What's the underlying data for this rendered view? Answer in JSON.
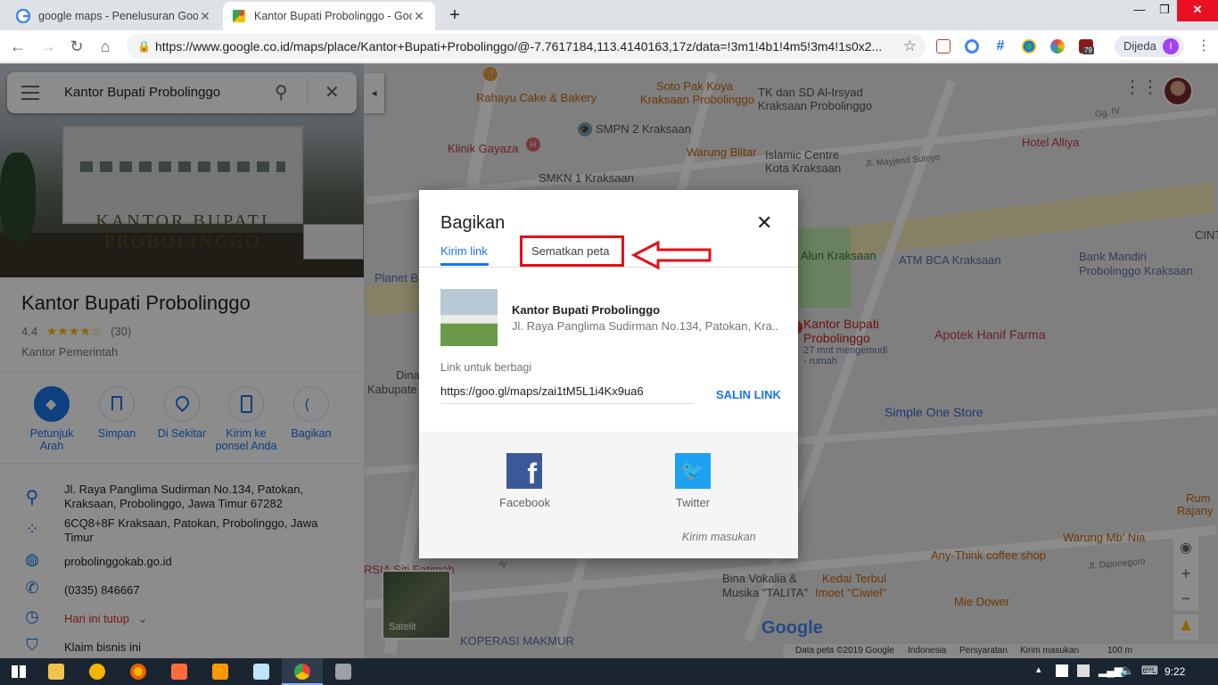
{
  "browser": {
    "tabs": [
      {
        "title": "google maps - Penelusuran Goog",
        "icon": "google-g-icon"
      },
      {
        "title": "Kantor Bupati Probolinggo - Goo",
        "icon": "google-maps-icon"
      }
    ],
    "new_tab": "+",
    "url": "https://www.google.co.id/maps/place/Kantor+Bupati+Probolinggo/@-7.7617184,113.4140163,17z/data=!3m1!4b1!4m5!3m4!1s0x2...",
    "profile_label": "Dijeda",
    "profile_initial": "I",
    "extension_badge": "79"
  },
  "search": {
    "query": "Kantor Bupati Probolinggo"
  },
  "place": {
    "hero_caption": "KANTOR BUPATI PROBOLINGGO",
    "name": "Kantor Bupati Probolinggo",
    "rating": "4,4",
    "stars": 4.4,
    "reviews": "(30)",
    "category": "Kantor Pemerintah",
    "actions": [
      {
        "label": "Petunjuk",
        "label2": "Arah",
        "icon": "directions-icon"
      },
      {
        "label": "Simpan",
        "label2": "",
        "icon": "bookmark-icon"
      },
      {
        "label": "Di Sekitar",
        "label2": "",
        "icon": "nearby-icon"
      },
      {
        "label": "Kirim ke",
        "label2": "ponsel Anda",
        "icon": "send-to-phone-icon"
      },
      {
        "label": "Bagikan",
        "label2": "",
        "icon": "share-icon"
      }
    ],
    "address_line1": "Jl. Raya Panglima Sudirman No.134, Patokan,",
    "address_line2": "Kraksaan, Probolinggo, Jawa Timur 67282",
    "pluscode_line1": "6CQ8+8F Kraksaan, Patokan, Probolinggo, Jawa",
    "pluscode_line2": "Timur",
    "website": "probolinggokab.go.id",
    "phone": "(0335) 846667",
    "hours": "Hari ini tutup",
    "claim": "Klaim bisnis ini"
  },
  "dialog": {
    "title": "Bagikan",
    "tab_link": "Kirim link",
    "tab_embed": "Sematkan peta",
    "place_name": "Kantor Bupati Probolinggo",
    "place_address": "Jl. Raya Panglima Sudirman No.134, Patokan, Kra...",
    "link_label": "Link untuk berbagi",
    "link_value": "https://goo.gl/maps/zai1tM5L1i4Kx9ua6",
    "copy_button": "SALIN LINK",
    "facebook": "Facebook",
    "twitter": "Twitter",
    "feedback": "Kirim masukan"
  },
  "map": {
    "labels": [
      "Soto Pak Koya",
      "Kraksaan Probolinggo",
      "TK dan SD Al-Irsyad",
      "Kraksaan Probolinggo",
      "Rahayu Cake & Bakery",
      "SMPN 2 Kraksaan",
      "Klinik Gayaza",
      "Warung Blitar",
      "Islamic Centre",
      "Kota Kraksaan",
      "Hotel Alliya",
      "SMKN 1 Kraksaan",
      "Alun Kraksaan",
      "ATM BCA Kraksaan",
      "Bank Mandiri",
      "Probolinggo Kraksaan",
      "Kantor Bupati",
      "Probolinggo",
      "27 mnt mengemudi",
      "- rumah",
      "Apotek Hanif Farma",
      "Simple One Store",
      "Planet B",
      "Dinas",
      "Kabupate",
      "Warung Mb' Nia",
      "Any-Think coffee shop",
      "Bina Vokalia &",
      "Musika \"TALITA\"",
      "Kedai Terbul",
      "Imoet \"Ciwiel\"",
      "Mie Dower",
      "KOPERASI MAKMUR",
      "RSIA Siti Fatimah",
      "Rum",
      "Rajany",
      "CINT",
      "Gg. IV",
      "Jl. Mayjend Sutoyo",
      "Jl. Diponegoro",
      "Jl."
    ],
    "satellite_label": "Satelit",
    "logo": "Google",
    "footer": [
      "Data peta ©2019 Google",
      "Indonesia",
      "Persyaratan",
      "Kirim masukan",
      "100 m"
    ]
  },
  "taskbar": {
    "time": "9:22"
  },
  "colors": {
    "accent": "#1a73e8",
    "annotation": "#e0121b",
    "facebook": "#3b5998",
    "twitter": "#1da1f2"
  }
}
